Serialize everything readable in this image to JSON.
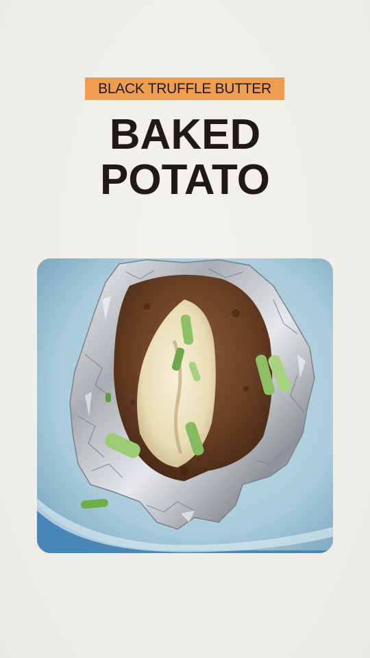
{
  "badge": {
    "text": "BLACK TRUFFLE BUTTER"
  },
  "title": {
    "line1": "BAKED",
    "line2": "POTATO"
  },
  "photo": {
    "subject": "baked-potato-in-foil"
  },
  "colors": {
    "background": "#f1efeb",
    "badge": "#ef9d4e",
    "title": "#1f1a17",
    "plate": "#b8d5e2"
  }
}
